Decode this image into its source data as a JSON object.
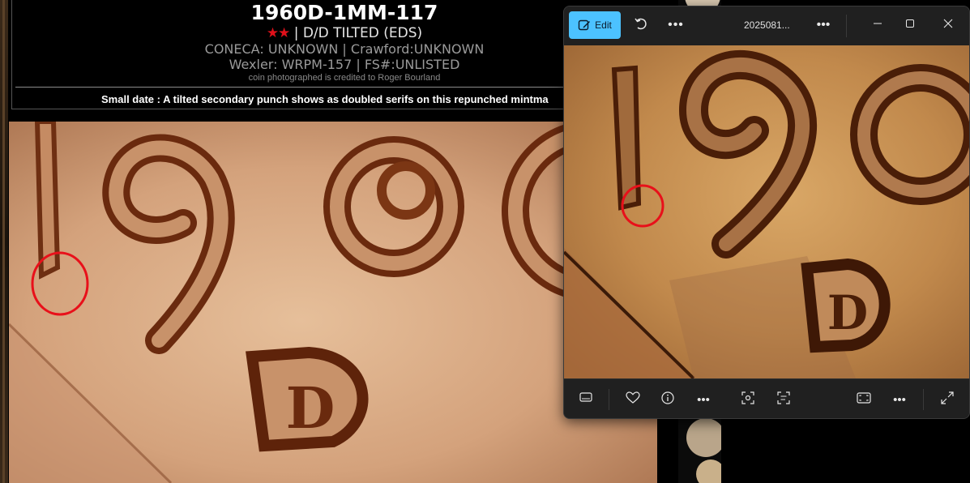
{
  "listing": {
    "title": "1960D-1MM-117",
    "stars": "★★",
    "variety": " | D/D TILTED (EDS)",
    "references_line1": "CONECA: UNKNOWN  |  Crawford:UNKNOWN",
    "references_line2": "Wexler: WRPM-157  |  FS#:UNLISTED",
    "photo_credit": "coin photographed is credited to Roger Bourland",
    "description": "Small date : A tilted secondary punch shows as doubled serifs on this repunched mintma"
  },
  "viewer": {
    "edit_label": "Edit",
    "filename": "2025081...",
    "more_label": "•••",
    "colors": {
      "accent": "#4cc2ff",
      "window_bg": "#202020",
      "marker": "#e8101a"
    }
  },
  "coin_text": {
    "left_digits": "196",
    "left_mint": "D",
    "right_digits": "196",
    "right_mint": "D"
  },
  "icons": {
    "titlebar": [
      "edit-icon",
      "rotate-icon",
      "more-icon",
      "more-icon",
      "minimize-icon",
      "maximize-icon",
      "close-icon"
    ],
    "bottom_toolbar": [
      "filmstrip-icon",
      "favorite-icon",
      "info-icon",
      "more-icon",
      "visual-search-icon",
      "text-scan-icon",
      "fit-icon",
      "more-icon",
      "fullscreen-icon"
    ]
  }
}
